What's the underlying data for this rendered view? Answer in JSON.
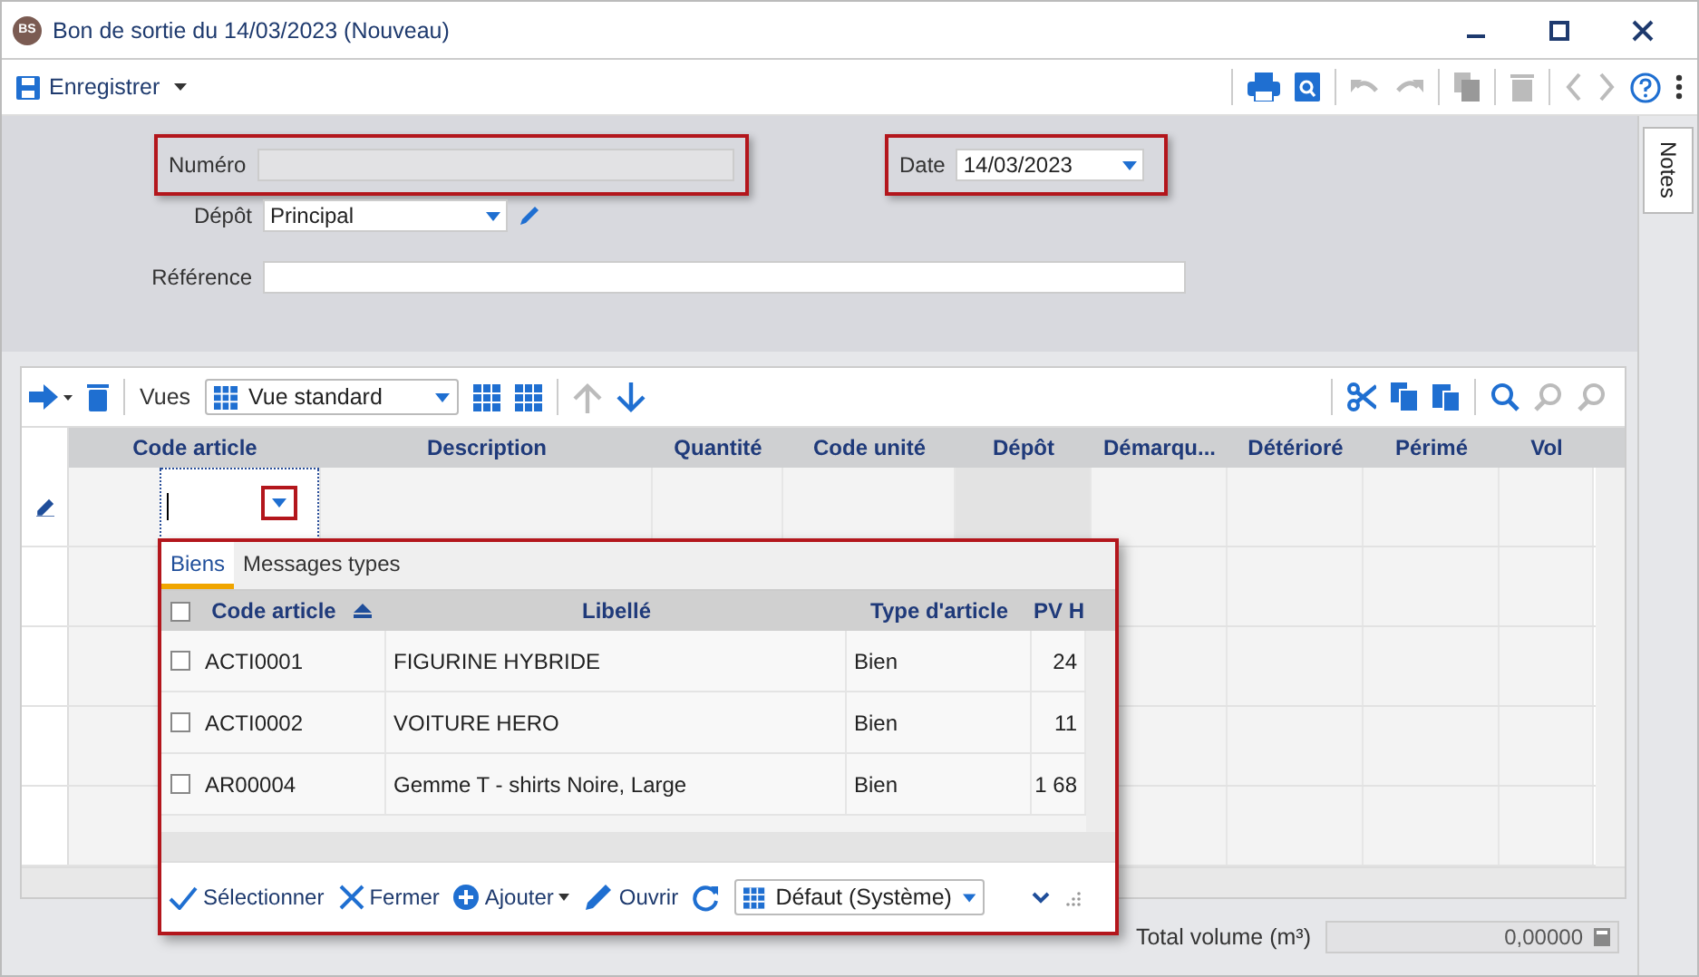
{
  "window": {
    "badge": "BS",
    "title": "Bon de sortie du 14/03/2023 (Nouveau)"
  },
  "toolbar": {
    "save_label": "Enregistrer"
  },
  "notes_tab": {
    "label": "Notes"
  },
  "form": {
    "numero": {
      "label": "Numéro"
    },
    "date": {
      "label": "Date",
      "value": "14/03/2023"
    },
    "depot": {
      "label": "Dépôt",
      "value": "Principal"
    },
    "reference": {
      "label": "Référence"
    }
  },
  "grid": {
    "views_label": "Vues",
    "view": "Vue standard",
    "columns": [
      "Code article",
      "Description",
      "Quantité",
      "Code unité",
      "Dépôt",
      "Démarqu...",
      "Détérioré",
      "Périmé",
      "Vol"
    ]
  },
  "popup": {
    "tabs": [
      {
        "label": "Biens",
        "selected": true
      },
      {
        "label": "Messages types",
        "selected": false
      }
    ],
    "select_all_checked": false,
    "columns": [
      "Code article",
      "Libellé",
      "Type d'article",
      "PV H"
    ],
    "rows": [
      {
        "checked": false,
        "code": "ACTI0001",
        "label": "FIGURINE HYBRIDE",
        "type": "Bien",
        "price": "24"
      },
      {
        "checked": false,
        "code": "ACTI0002",
        "label": "VOITURE HERO",
        "type": "Bien",
        "price": "11"
      },
      {
        "checked": false,
        "code": "AR00004",
        "label": "Gemme T - shirts Noire, Large",
        "type": "Bien",
        "price": "1 68"
      }
    ],
    "footer": {
      "select": "Sélectionner",
      "close": "Fermer",
      "add": "Ajouter",
      "open": "Ouvrir",
      "layout": "Défaut (Système)"
    }
  },
  "totals": {
    "volume_label": "Total volume (m³)",
    "volume_value": "0,00000"
  }
}
